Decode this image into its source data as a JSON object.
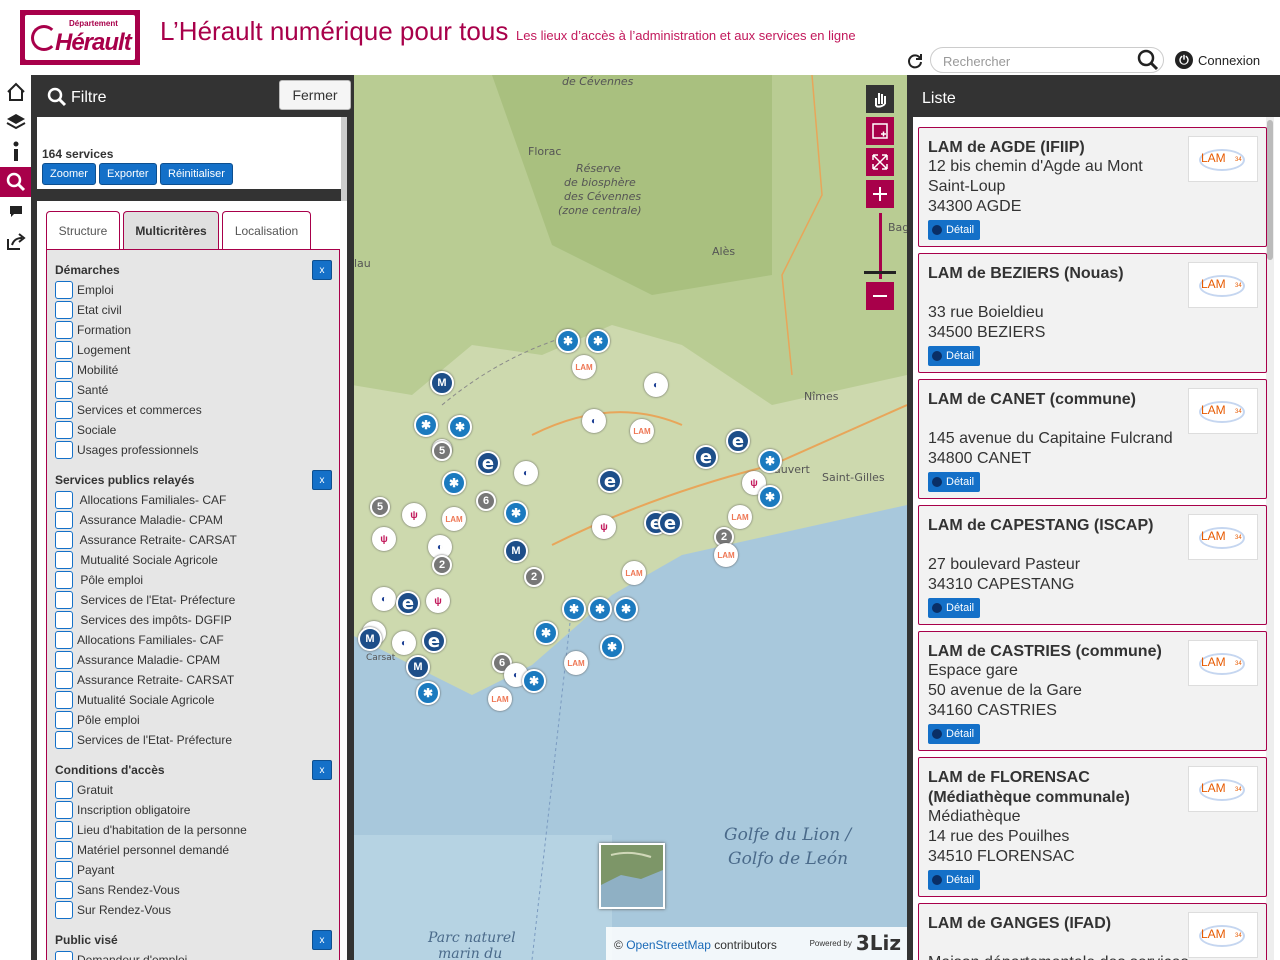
{
  "header": {
    "logo_top": "Département",
    "logo_name": "Hérault",
    "title": "L’Hérault numérique pour tous",
    "subtitle": "Les lieux d’accès à l’administration et aux services en ligne",
    "search_placeholder": "Rechercher",
    "connect_label": "Connexion"
  },
  "colors": {
    "brand": "#a8004a",
    "button": "#1470c8",
    "panel": "#333333"
  },
  "dock": {
    "items": [
      {
        "icon": "home-icon"
      },
      {
        "icon": "layers-icon"
      },
      {
        "icon": "info-icon"
      },
      {
        "icon": "search-icon"
      },
      {
        "icon": "comment-icon"
      },
      {
        "icon": "share-icon"
      }
    ]
  },
  "filter": {
    "title": "Filtre",
    "close_label": "Fermer",
    "count": "164 services",
    "buttons": {
      "zoom": "Zoomer",
      "export": "Exporter",
      "reset": "Réinitialiser"
    },
    "tabs": [
      "Structure",
      "Multicritères",
      "Localisation"
    ],
    "sections": {
      "demarches": {
        "title": "Démarches",
        "clear": "x",
        "items": [
          "Emploi",
          "Etat civil",
          "Formation",
          "Logement",
          "Mobilité",
          "Santé",
          "Services et commerces",
          "Sociale",
          "Usages professionnels"
        ]
      },
      "services": {
        "title": "Services publics relayés",
        "clear": "x",
        "items": [
          " Allocations Familiales- CAF",
          " Assurance Maladie- CPAM",
          " Assurance Retraite- CARSAT",
          " Mutualité Sociale Agricole",
          " Pôle emploi",
          " Services de l'Etat- Préfecture",
          " Services des impôts- DGFIP",
          "Allocations Familiales- CAF",
          "Assurance Maladie- CPAM",
          "Assurance Retraite- CARSAT",
          "Mutualité Sociale Agricole",
          "Pôle emploi",
          "Services de l'Etat- Préfecture"
        ]
      },
      "conditions": {
        "title": "Conditions d'accès",
        "clear": "x",
        "items": [
          "Gratuit",
          "Inscription obligatoire",
          "Lieu d'habitation de la personne",
          "Matériel personnel demandé",
          "Payant",
          "Sans Rendez-Vous",
          "Sur Rendez-Vous"
        ]
      },
      "public": {
        "title": "Public visé",
        "clear": "x",
        "items": [
          "Demandeur d'emploi"
        ]
      }
    }
  },
  "map": {
    "labels": {
      "florac": "Florac",
      "reserve1": "Réserve",
      "reserve2": "de biosphère",
      "reserve3": "des Cévennes",
      "reserve4": "(zone centrale)",
      "cevennes": "de Cévennes",
      "ales": "Alès",
      "nimes": "Nîmes",
      "stgilles": "Saint-Gilles",
      "vauvert": "auvert",
      "bag": "Bag",
      "lau": "lau",
      "golfe1": "Golfe du Lion /",
      "golfe2": "Golfo de León",
      "parc1": "Parc naturel",
      "parc2": "marin du",
      "carsat": "Carsat"
    },
    "attribution_prefix": "© ",
    "attribution_link": "OpenStreetMap",
    "attribution_suffix": " contributors",
    "powered_by": "Powered by",
    "powered_brand": "3Liz",
    "tool_icons": [
      "pan-icon",
      "zoom-box-icon",
      "zoom-extent-icon",
      "zoom-in-icon",
      "zoom-slider",
      "zoom-out-icon"
    ],
    "markers": [
      {
        "type": "e",
        "label": "e"
      },
      {
        "type": "lam",
        "label": "LAM"
      },
      {
        "type": "cl",
        "label": "✱"
      },
      {
        "type": "fr",
        "label": "◐"
      },
      {
        "type": "cnt",
        "label": "5"
      },
      {
        "type": "cnt",
        "label": "6"
      },
      {
        "type": "cnt",
        "label": "2"
      },
      {
        "type": "pk",
        "label": "ψ"
      },
      {
        "type": "g",
        "label": "M"
      }
    ]
  },
  "list": {
    "title": "Liste",
    "detail_label": "Détail",
    "logo_text": "LAM",
    "logo_small": "34",
    "cards": [
      {
        "name": "LAM de AGDE (IFIIP)",
        "lines": [
          "12 bis chemin d'Agde au Mont",
          "Saint-Loup",
          "34300 AGDE"
        ]
      },
      {
        "name": "LAM de BEZIERS (Nouas)",
        "lines": [
          "33 rue Boieldieu",
          "34500 BEZIERS"
        ]
      },
      {
        "name": "LAM de CANET (commune)",
        "lines": [
          "145 avenue du Capitaine Fulcrand",
          "34800 CANET"
        ]
      },
      {
        "name": "LAM de CAPESTANG (ISCAP)",
        "lines": [
          "27 boulevard Pasteur",
          "34310 CAPESTANG"
        ]
      },
      {
        "name": "LAM de CASTRIES (commune)",
        "lines": [
          "Espace gare",
          "50 avenue de la Gare",
          "34160 CASTRIES"
        ]
      },
      {
        "name": "LAM de FLORENSAC (Médiathèque communale)",
        "lines": [
          "Médiathèque",
          "14 rue des Pouilhes",
          "34510 FLORENSAC"
        ]
      },
      {
        "name": "LAM de GANGES (IFAD)",
        "lines": [
          "Maison départementale des services"
        ]
      }
    ]
  }
}
